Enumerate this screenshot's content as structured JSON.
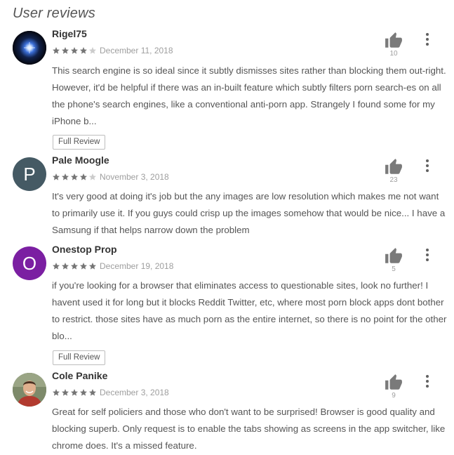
{
  "section": {
    "title": "User reviews"
  },
  "colors": {
    "avatar_pale_moogle": "#455a64",
    "avatar_onestop_prop": "#7b1fa2",
    "star_on": "#757575",
    "star_off": "#cccccc"
  },
  "icons": {
    "thumb": "thumb-up-icon",
    "more": "more-vertical-icon",
    "star": "star-icon"
  },
  "reviews": [
    {
      "author": "Rigel75",
      "rating": 4,
      "date": "December 11, 2018",
      "likes": "10",
      "text": "This search engine is so ideal since it subtly dismisses sites rather than blocking them out-right. However, it'd be helpful if there was an in-built feature which subtly filters porn search-es on all the phone's search engines, like a conventional anti-porn app. Strangely I found some for my iPhone b...",
      "full_review_label": "Full Review"
    },
    {
      "author": "Pale Moogle",
      "avatar_letter": "P",
      "rating": 4,
      "date": "November 3, 2018",
      "likes": "23",
      "text": "It's very good at doing it's job but the any images are low resolution which makes me not want to primarily use it. If you guys could crisp up the images somehow that would be nice... I have a Samsung if that helps narrow down the problem"
    },
    {
      "author": "Onestop Prop",
      "avatar_letter": "O",
      "rating": 5,
      "date": "December 19, 2018",
      "likes": "5",
      "text": "if you're looking for a browser that eliminates access to questionable sites, look no further! I havent used it for long but it blocks Reddit Twitter, etc, where most porn block apps dont bother to restrict. those sites have as much porn as the entire internet, so there is no point for the other blo...",
      "full_review_label": "Full Review"
    },
    {
      "author": "Cole Panike",
      "rating": 5,
      "date": "December 3, 2018",
      "likes": "9",
      "text": "Great for self policiers and those who don't want to be surprised! Browser is good quality and blocking superb. Only request is to enable the tabs showing as screens in the app switcher, like chrome does. It's a missed feature."
    }
  ]
}
